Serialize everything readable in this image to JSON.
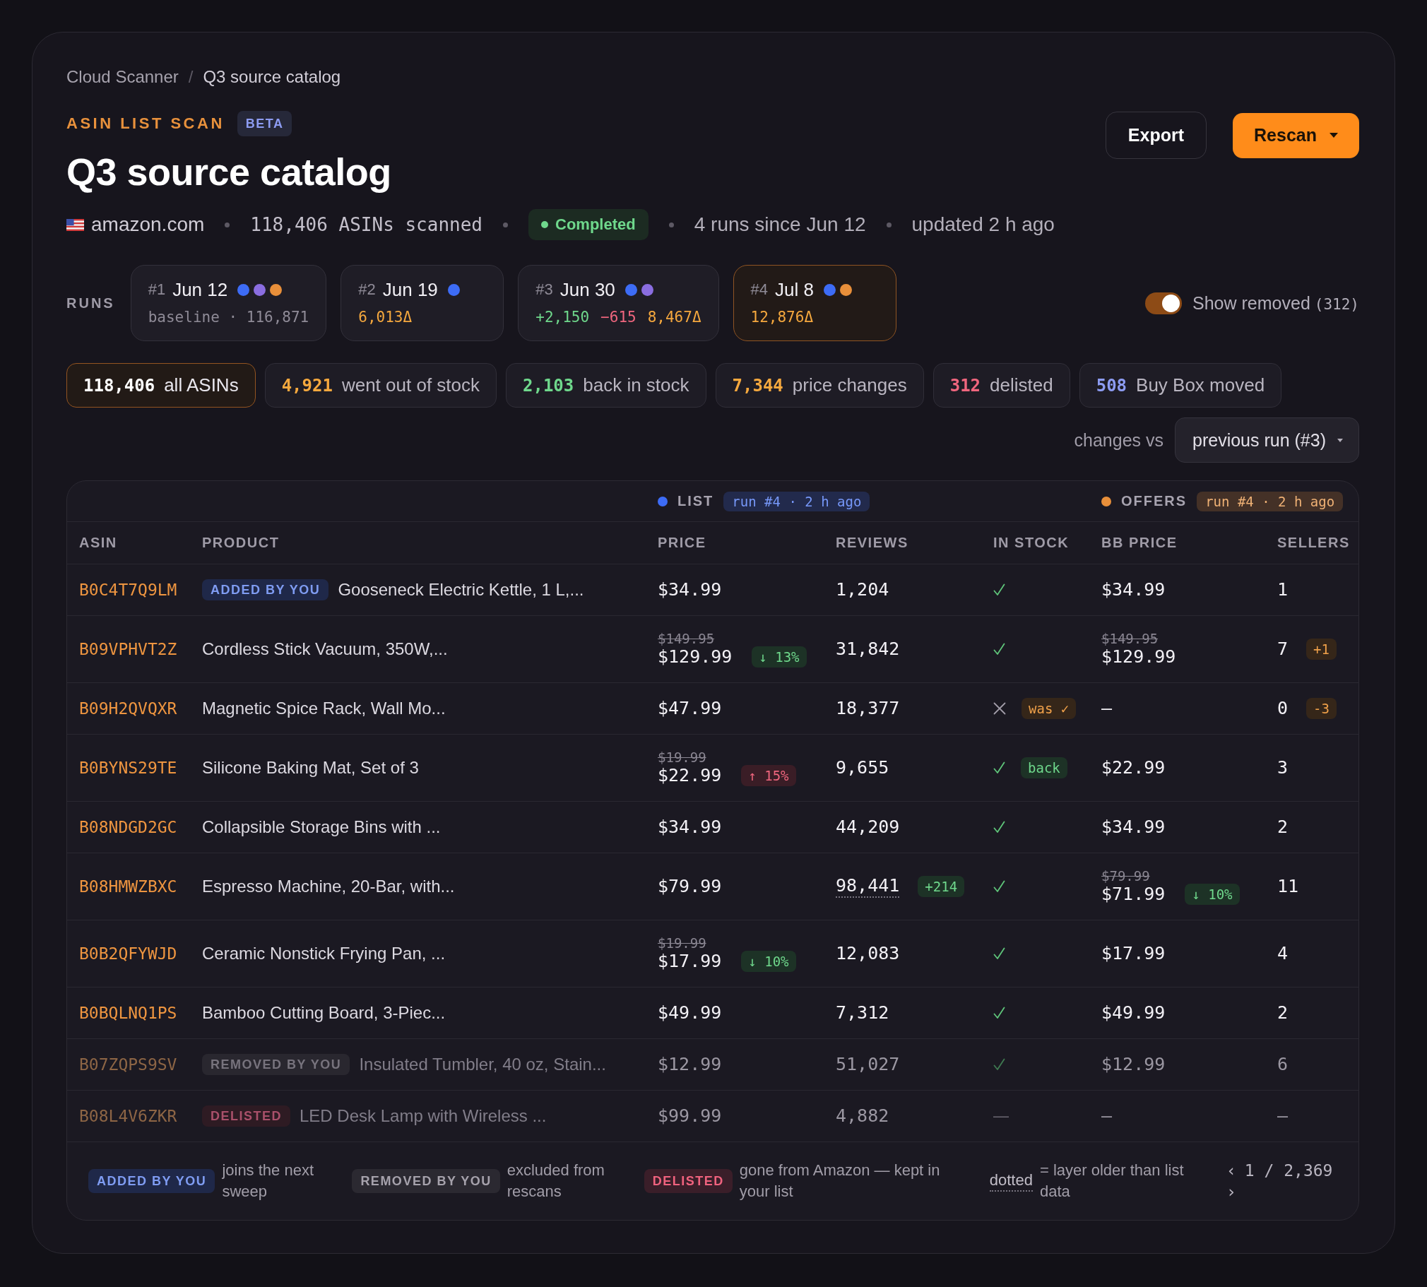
{
  "breadcrumb": {
    "items": [
      "Cloud Scanner",
      "Q3 source catalog"
    ],
    "separator": "/"
  },
  "header": {
    "eyebrow": "ASIN LIST SCAN",
    "badge": "BETA",
    "title": "Q3 source catalog"
  },
  "actions": [
    {
      "label": "Export",
      "kind": "secondary",
      "dropdown": false
    },
    {
      "label": "Rescan",
      "kind": "primary",
      "dropdown": true
    }
  ],
  "meta": {
    "marketplace": "amazon.com",
    "scanned": "118,406 ASINs scanned",
    "status": "Completed",
    "runs_summary": "4 runs since Jun 12",
    "updated": "updated 2 h ago"
  },
  "runs": {
    "label": "RUNS",
    "items": [
      {
        "number": "#1",
        "date": "Jun 12",
        "selected": false,
        "layers": [
          {
            "color": "#3d6cf6"
          },
          {
            "color": "#8a6de0"
          },
          {
            "color": "#e88f3a"
          }
        ],
        "stats": [
          {
            "text": "baseline · 116,871",
            "kind": "baseline"
          }
        ]
      },
      {
        "number": "#2",
        "date": "Jun 19",
        "selected": false,
        "layers": [
          {
            "color": "#3d6cf6"
          }
        ],
        "stats": [
          {
            "text": "6,013Δ",
            "kind": "delta"
          }
        ]
      },
      {
        "number": "#3",
        "date": "Jun 30",
        "selected": false,
        "layers": [
          {
            "color": "#3d6cf6"
          },
          {
            "color": "#8a6de0"
          }
        ],
        "stats": [
          {
            "text": "+2,150",
            "kind": "added"
          },
          {
            "text": "−615",
            "kind": "removed"
          },
          {
            "text": "8,467Δ",
            "kind": "delta"
          }
        ]
      },
      {
        "number": "#4",
        "date": "Jul 8",
        "selected": true,
        "layers": [
          {
            "color": "#3d6cf6"
          },
          {
            "color": "#e88f3a"
          }
        ],
        "stats": [
          {
            "text": "12,876Δ",
            "kind": "delta"
          }
        ]
      }
    ]
  },
  "show_removed": {
    "label": "Show removed",
    "count": "(312)",
    "on": true
  },
  "chips": [
    {
      "count": "118,406",
      "label": "all ASINs",
      "color": "#ffffff",
      "selected": true
    },
    {
      "count": "4,921",
      "label": "went out of stock",
      "color": "#f5a83e",
      "selected": false
    },
    {
      "count": "2,103",
      "label": "back in stock",
      "color": "#6fd88c",
      "selected": false
    },
    {
      "count": "7,344",
      "label": "price changes",
      "color": "#f5a83e",
      "selected": false
    },
    {
      "count": "312",
      "label": "delisted",
      "color": "#f0667e",
      "selected": false
    },
    {
      "count": "508",
      "label": "Buy Box moved",
      "color": "#8d9cf2",
      "selected": false
    }
  ],
  "compare": {
    "label": "changes vs",
    "value": "previous run (#3)"
  },
  "table": {
    "groups": [
      {
        "label": "LIST",
        "run": "run #4 · 2 h ago",
        "color": "#3d6cf6"
      },
      {
        "label": "OFFERS",
        "run": "run #4 · 2 h ago",
        "color": "#e88f3a"
      }
    ],
    "columns": [
      "ASIN",
      "PRODUCT",
      "PRICE",
      "REVIEWS",
      "IN STOCK",
      "BB PRICE",
      "SELLERS"
    ],
    "rows": [
      {
        "asin": "B0C4T7Q9LM",
        "kind": "added",
        "tag": "ADDED BY YOU",
        "product": "Gooseneck Electric Kettle, 1 L,...",
        "price": {
          "now": "$34.99"
        },
        "reviews": {
          "value": "1,204",
          "stale": false
        },
        "stock": {
          "kind": "check"
        },
        "bb_price": {
          "now": "$34.99"
        },
        "sellers": {
          "value": "1"
        }
      },
      {
        "asin": "B09VPHVT2Z",
        "kind": "normal",
        "product": "Cordless Stick Vacuum, 350W,...",
        "price": {
          "was": "$149.95",
          "now": "$129.99",
          "change": {
            "text": "↓ 13%",
            "kind": "decrease"
          }
        },
        "reviews": {
          "value": "31,842",
          "stale": false
        },
        "stock": {
          "kind": "check"
        },
        "bb_price": {
          "was": "$149.95",
          "now": "$129.99"
        },
        "sellers": {
          "value": "7",
          "change": "+1"
        }
      },
      {
        "asin": "B09H2QVQXR",
        "kind": "normal",
        "product": "Magnetic Spice Rack, Wall Mo...",
        "price": {
          "now": "$47.99"
        },
        "reviews": {
          "value": "18,377",
          "stale": false
        },
        "stock": {
          "kind": "cross",
          "badge": {
            "text": "was ✓",
            "kind": "warning"
          }
        },
        "bb_price": {
          "now": "—"
        },
        "sellers": {
          "value": "0",
          "change": "-3"
        }
      },
      {
        "asin": "B0BYNS29TE",
        "kind": "normal",
        "product": "Silicone Baking Mat, Set of 3",
        "price": {
          "was": "$19.99",
          "now": "$22.99",
          "change": {
            "text": "↑ 15%",
            "kind": "increase"
          }
        },
        "reviews": {
          "value": "9,655",
          "stale": false
        },
        "stock": {
          "kind": "check",
          "badge": {
            "text": "back",
            "kind": "positive"
          }
        },
        "bb_price": {
          "now": "$22.99"
        },
        "sellers": {
          "value": "3"
        }
      },
      {
        "asin": "B08NDGD2GC",
        "kind": "normal",
        "product": "Collapsible Storage Bins with ...",
        "price": {
          "now": "$34.99"
        },
        "reviews": {
          "value": "44,209",
          "stale": false
        },
        "stock": {
          "kind": "check"
        },
        "bb_price": {
          "now": "$34.99"
        },
        "sellers": {
          "value": "2"
        }
      },
      {
        "asin": "B08HMWZBXC",
        "kind": "normal",
        "product": "Espresso Machine, 20-Bar, with...",
        "price": {
          "now": "$79.99"
        },
        "reviews": {
          "value": "98,441",
          "stale": true,
          "change": "+214"
        },
        "stock": {
          "kind": "check"
        },
        "bb_price": {
          "was": "$79.99",
          "now": "$71.99",
          "change": {
            "text": "↓ 10%",
            "kind": "decrease"
          }
        },
        "sellers": {
          "value": "11"
        }
      },
      {
        "asin": "B0B2QFYWJD",
        "kind": "normal",
        "product": "Ceramic Nonstick Frying Pan, ...",
        "price": {
          "was": "$19.99",
          "now": "$17.99",
          "change": {
            "text": "↓ 10%",
            "kind": "decrease"
          }
        },
        "reviews": {
          "value": "12,083",
          "stale": false
        },
        "stock": {
          "kind": "check"
        },
        "bb_price": {
          "now": "$17.99"
        },
        "sellers": {
          "value": "4"
        }
      },
      {
        "asin": "B0BQLNQ1PS",
        "kind": "normal",
        "product": "Bamboo Cutting Board, 3-Piec...",
        "price": {
          "now": "$49.99"
        },
        "reviews": {
          "value": "7,312",
          "stale": false
        },
        "stock": {
          "kind": "check"
        },
        "bb_price": {
          "now": "$49.99"
        },
        "sellers": {
          "value": "2"
        }
      },
      {
        "asin": "B07ZQPS9SV",
        "kind": "removed",
        "tag": "REMOVED BY YOU",
        "product": "Insulated Tumbler, 40 oz, Stain...",
        "price": {
          "now": "$12.99"
        },
        "reviews": {
          "value": "51,027",
          "stale": false
        },
        "stock": {
          "kind": "check"
        },
        "bb_price": {
          "now": "$12.99"
        },
        "sellers": {
          "value": "6"
        }
      },
      {
        "asin": "B08L4V6ZKR",
        "kind": "delisted",
        "tag": "DELISTED",
        "product": "LED Desk Lamp with Wireless ...",
        "price": {
          "now": "$99.99"
        },
        "reviews": {
          "value": "4,882",
          "stale": false
        },
        "stock": {
          "kind": "none",
          "text": "—"
        },
        "bb_price": {
          "now": "—"
        },
        "sellers": {
          "value": "—"
        }
      }
    ]
  },
  "legend": [
    {
      "kind": "added",
      "key": "ADDED BY YOU",
      "text": "joins the next sweep"
    },
    {
      "kind": "removed",
      "key": "REMOVED BY YOU",
      "text": "excluded from rescans"
    },
    {
      "kind": "delisted",
      "key": "DELISTED",
      "text": "gone from Amazon — kept in your list"
    },
    {
      "kind": "dotted",
      "key": "dotted",
      "text": "= layer older than list data"
    }
  ],
  "pagination": {
    "prev": "‹",
    "page": "1 / 2,369",
    "next": "›"
  }
}
